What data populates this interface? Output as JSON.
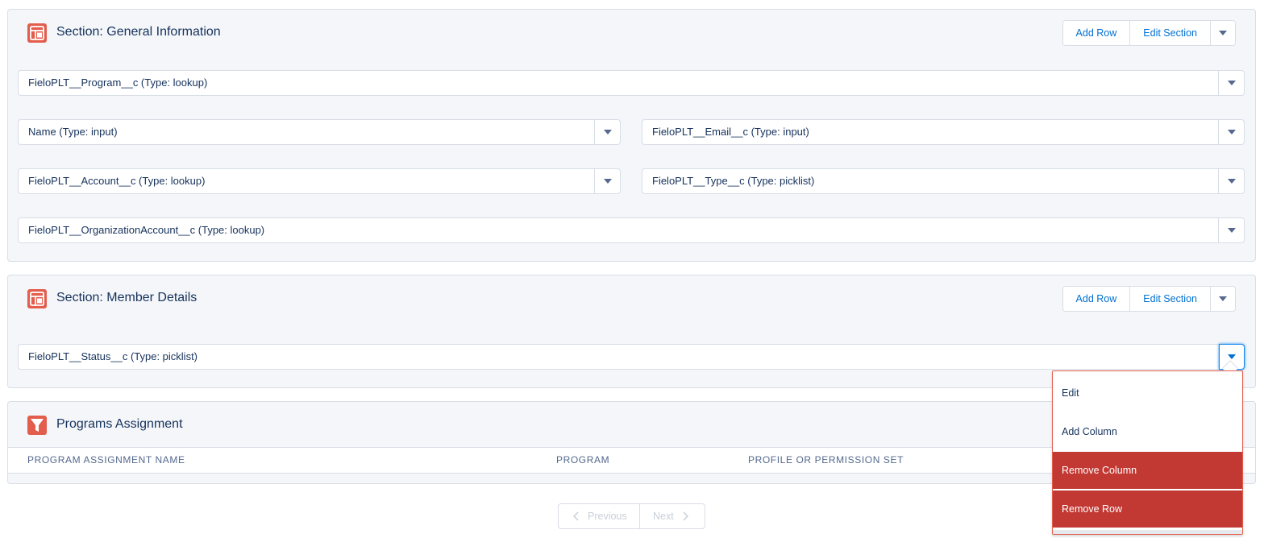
{
  "section1": {
    "title": "Section: General Information",
    "add_row": "Add Row",
    "edit_section": "Edit Section",
    "fields": {
      "program": "FieloPLT__Program__c (Type: lookup)",
      "name": "Name (Type: input)",
      "email": "FieloPLT__Email__c (Type: input)",
      "account": "FieloPLT__Account__c (Type: lookup)",
      "type": "FieloPLT__Type__c (Type: picklist)",
      "org_account": "FieloPLT__OrganizationAccount__c (Type: lookup)"
    }
  },
  "section2": {
    "title": "Section: Member Details",
    "add_row": "Add Row",
    "edit_section": "Edit Section",
    "fields": {
      "status": "FieloPLT__Status__c (Type: picklist)"
    }
  },
  "programs": {
    "title": "Programs Assignment",
    "columns": [
      "PROGRAM ASSIGNMENT NAME",
      "PROGRAM",
      "PROFILE OR PERMISSION SET"
    ]
  },
  "pager": {
    "previous": "Previous",
    "next": "Next"
  },
  "menu": {
    "items": [
      "Edit",
      "Add Column",
      "Remove Column",
      "Remove Row"
    ]
  },
  "colors": {
    "brand_blue": "#0070d2",
    "section_icon": "#e35d4d",
    "danger": "#c23934"
  },
  "icons": {
    "section": "layout-section-icon",
    "programs": "filter-funnel-icon"
  }
}
